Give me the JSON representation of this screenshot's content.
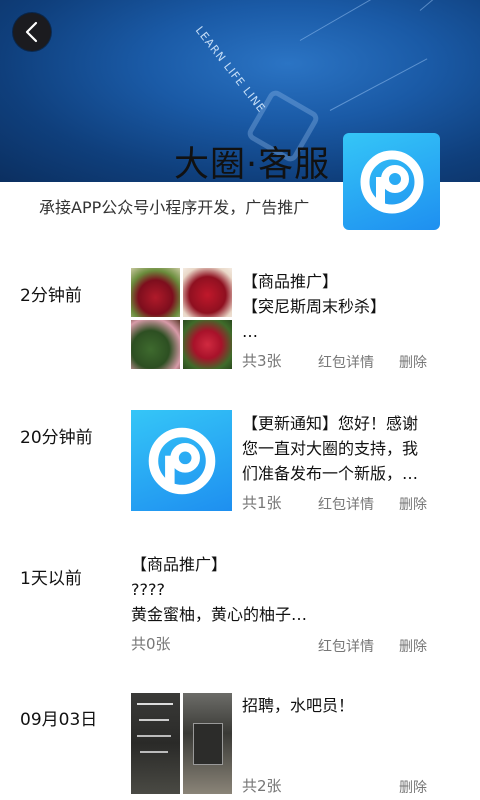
{
  "header": {
    "banner_text": "LEARN LIFE LINE",
    "title": "大圈·客服",
    "subtitle": "承接APP公众号小程序开发，广告推广"
  },
  "colors": {
    "banner_dark": "#0b2f60",
    "banner_light": "#2b74c4",
    "logo_top": "#35c6f7",
    "logo_bottom": "#1e8ff0",
    "meta_text": "#777777"
  },
  "posts": [
    {
      "time": "2分钟前",
      "lines": [
        "【商品推广】",
        "【突尼斯周末秒杀】",
        "…"
      ],
      "count": "共3张",
      "detail": "红包详情",
      "delete": "删除",
      "thumb": "pomegranate-collage"
    },
    {
      "time": "20分钟前",
      "lines": [
        "【更新通知】您好！感谢",
        "您一直对大圈的支持，我",
        "们准备发布一个新版，…"
      ],
      "count": "共1张",
      "detail": "红包详情",
      "delete": "删除",
      "thumb": "app-logo"
    },
    {
      "time": "1天以前",
      "lines": [
        "【商品推广】",
        "????",
        "黄金蜜柚，黄心的柚子…"
      ],
      "count": "共0张",
      "detail": "红包详情",
      "delete": "删除",
      "thumb": "none"
    },
    {
      "time": "09月03日",
      "lines": [
        "招聘，水吧员！"
      ],
      "count": "共2张",
      "delete": "删除",
      "thumb": "recruitment-photos"
    }
  ]
}
